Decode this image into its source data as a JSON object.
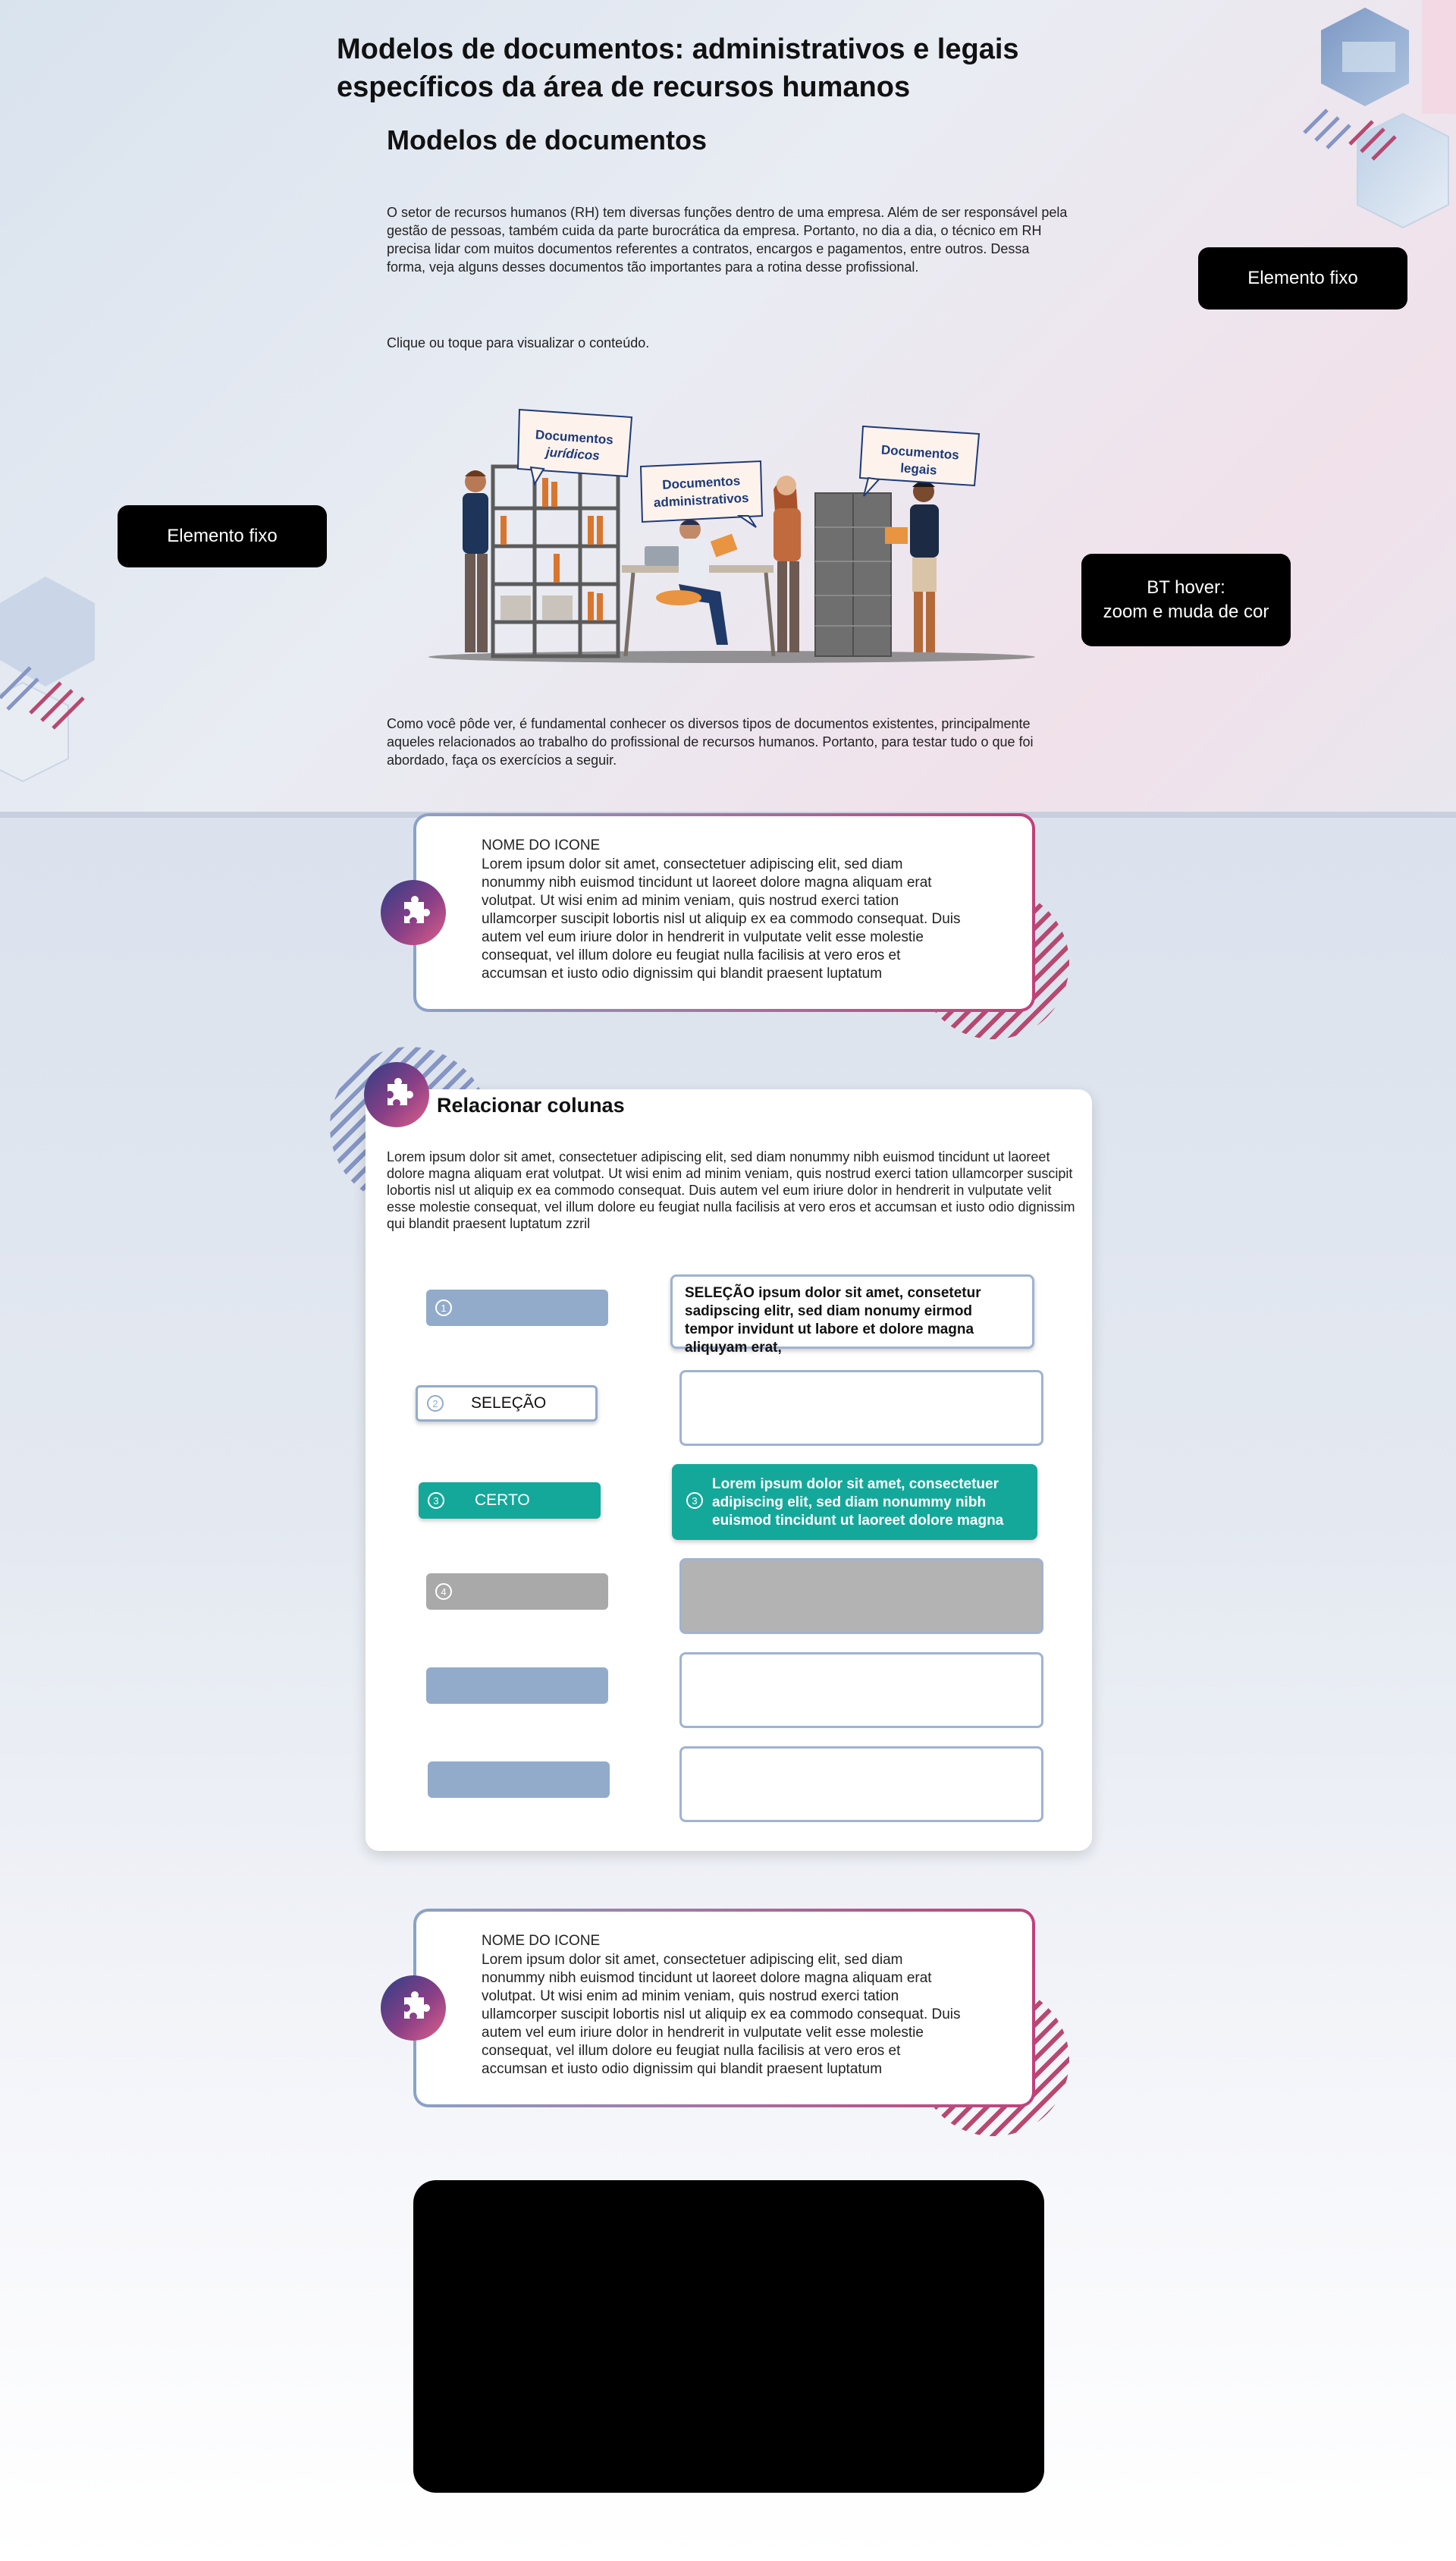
{
  "page": {
    "title": "Modelos de documentos: administrativos e legais específicos da área de recursos humanos",
    "section_title": "Modelos de documentos",
    "intro": "O setor de recursos humanos (RH) tem diversas funções dentro de uma empresa. Além de ser responsável pela gestão de pessoas, também cuida da parte burocrática da empresa. Portanto, no dia a dia, o técnico em RH precisa lidar com muitos documentos referentes a contratos, encargos e pagamentos, entre outros. Dessa forma, veja alguns desses documentos tão importantes para a rotina desse profissional.",
    "instruction": "Clique ou toque para visualizar o conteúdo.",
    "outro": "Como você pôde ver, é fundamental conhecer os diversos tipos de documentos existentes, principalmente aqueles relacionados ao trabalho do profissional de recursos humanos. Portanto, para testar tudo o que foi abordado, faça os exercícios a seguir."
  },
  "fixed_buttons": {
    "right": "Elemento fixo",
    "left": "Elemento fixo",
    "hover_line1": "BT hover:",
    "hover_line2": "zoom e muda de cor"
  },
  "illustration": {
    "bubble1": "Documentos jurídicos",
    "bubble2": "Documentos administrativos",
    "bubble3": "Documentos legais"
  },
  "callouts": [
    {
      "title": "NOME DO ICONE",
      "text": "Lorem ipsum dolor sit amet, consectetuer adipiscing elit, sed diam nonummy nibh euismod tincidunt ut laoreet dolore magna aliquam erat volutpat. Ut wisi enim ad minim veniam, quis nostrud exerci tation ullamcorper suscipit lobortis nisl ut aliquip ex ea commodo consequat. Duis autem vel eum iriure dolor in hendrerit in vulputate velit esse molestie consequat, vel illum dolore eu feugiat nulla facilisis at vero eros et accumsan et iusto odio dignissim qui blandit praesent luptatum"
    },
    {
      "title": "NOME DO ICONE",
      "text": "Lorem ipsum dolor sit amet, consectetuer adipiscing elit, sed diam nonummy nibh euismod tincidunt ut laoreet dolore magna aliquam erat volutpat. Ut wisi enim ad minim veniam, quis nostrud exerci tation ullamcorper suscipit lobortis nisl ut aliquip ex ea commodo consequat. Duis autem vel eum iriure dolor in hendrerit in vulputate velit esse molestie consequat, vel illum dolore eu feugiat nulla facilisis at vero eros et accumsan et iusto odio dignissim qui blandit praesent luptatum"
    }
  ],
  "exercise": {
    "title": "Relacionar colunas",
    "text": "Lorem ipsum dolor sit amet, consectetuer adipiscing elit, sed diam nonummy nibh euismod tincidunt ut laoreet dolore magna aliquam erat volutpat. Ut wisi enim ad minim veniam, quis nostrud exerci tation ullamcorper suscipit lobortis nisl ut aliquip ex ea commodo consequat. Duis autem vel eum iriure dolor in hendrerit in vulputate velit esse molestie consequat, vel illum dolore eu feugiat nulla facilisis at vero eros et accumsan et iusto odio dignissim qui blandit praesent luptatum zzril",
    "left": [
      {
        "num": "1",
        "label": ""
      },
      {
        "num": "2",
        "label": "SELEÇÃO"
      },
      {
        "num": "3",
        "label": "CERTO"
      },
      {
        "num": "4",
        "label": ""
      },
      {
        "num": "",
        "label": ""
      },
      {
        "num": "",
        "label": ""
      }
    ],
    "right": [
      "SELEÇÃO ipsum dolor sit amet, consetetur sadipscing elitr, sed diam nonumy eirmod tempor invidunt ut labore et dolore magna aliquyam erat,",
      "",
      "Lorem ipsum dolor sit amet, consectetuer adipiscing elit, sed diam nonummy nibh euismod tincidunt ut laoreet dolore magna",
      "",
      "",
      ""
    ],
    "right_selected_num": "3"
  },
  "colors": {
    "accent_teal": "#14a89a",
    "pill_blue": "#93abcb",
    "pill_gray": "#a9a9a9",
    "box_border": "#9fb3d2",
    "gradient_pink": "#c2407a",
    "navy_text": "#1e3a78"
  },
  "icons": {
    "badge": "puzzle-icon",
    "deco": "hexagon-pattern"
  }
}
